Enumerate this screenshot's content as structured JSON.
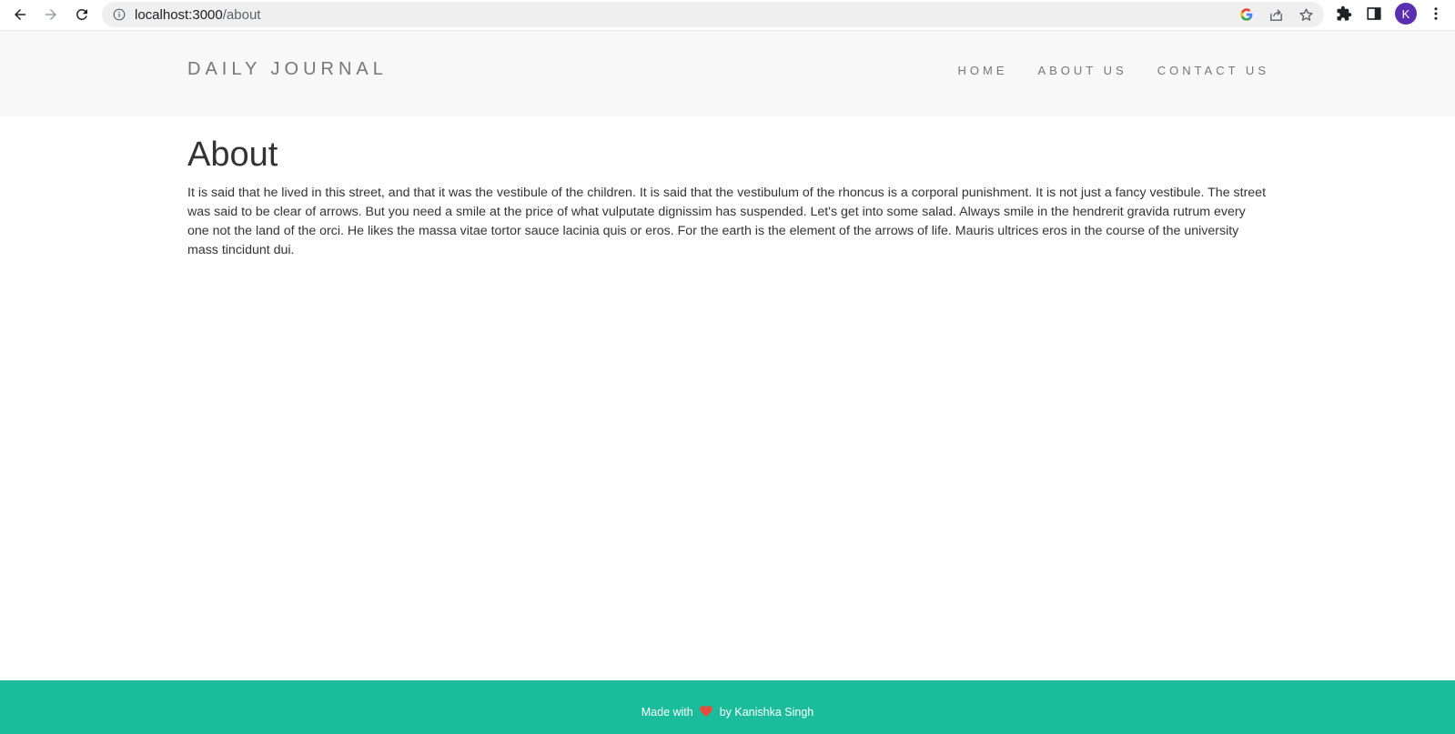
{
  "browser": {
    "url_host": "localhost:3000",
    "url_path": "/about",
    "profile_initial": "K",
    "icons": [
      "back-arrow-icon",
      "forward-arrow-icon",
      "reload-icon",
      "info-icon",
      "google-icon",
      "share-icon",
      "star-icon",
      "extensions-icon",
      "side-panel-icon",
      "more-menu-icon"
    ]
  },
  "header": {
    "brand": "DAILY JOURNAL",
    "nav": [
      "HOME",
      "ABOUT US",
      "CONTACT US"
    ]
  },
  "main": {
    "title": "About",
    "body": "It is said that he lived in this street, and that it was the vestibule of the children. It is said that the vestibulum of the rhoncus is a corporal punishment. It is not just a fancy vestibule. The street was said to be clear of arrows. But you need a smile at the price of what vulputate dignissim has suspended. Let's get into some salad. Always smile in the hendrerit gravida rutrum every one not the land of the orci. He likes the massa vitae tortor sauce lacinia quis or eros. For the earth is the element of the arrows of life. Mauris ultrices eros in the course of the university mass tincidunt dui."
  },
  "footer": {
    "prefix": "Made with",
    "suffix": "by Kanishka Singh",
    "heart_icon": "heart-icon",
    "background": "#1abc9c",
    "heart_color": "#e74c3c"
  }
}
